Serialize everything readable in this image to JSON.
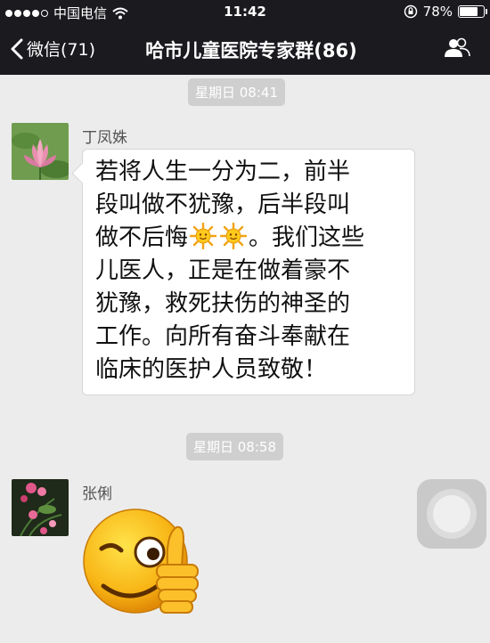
{
  "status_bar": {
    "carrier": "中国电信",
    "time": "11:42",
    "battery": "78%",
    "battery_level": 0.78,
    "signal_bars": 4
  },
  "nav": {
    "back_label": "微信(71)",
    "title": "哈市儿童医院专家群(86)",
    "contacts_icon": "people-icon"
  },
  "messages": [
    {
      "timestamp": "星期日 08:41",
      "sender": "丁凤姝",
      "avatar_icon": "lotus-avatar",
      "lines": [
        "若将人生一分为二，前半",
        "段叫做不犹豫，后半段叫",
        "做不后悔",
        "。我们这些",
        "儿医人，正是在做着豪不",
        "犹豫，救死扶伤的神圣的",
        "工作。向所有奋斗奉献在",
        "临床的医护人员致敬！"
      ],
      "emoji": [
        "sun-icon",
        "sun-icon"
      ]
    },
    {
      "timestamp": "星期日 08:58",
      "sender": "张俐",
      "avatar_icon": "flower-avatar",
      "sticker": "wink-thumbs-up-emoji"
    }
  ],
  "colors": {
    "bar": "#1b1a1f",
    "background": "#ececec",
    "chip": "#cfcfcf",
    "bubble": "#ffffff"
  }
}
